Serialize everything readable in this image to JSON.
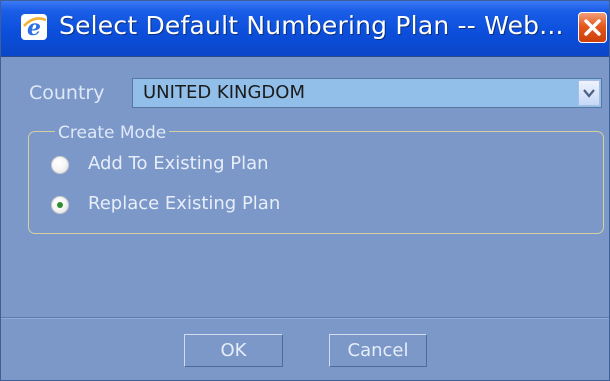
{
  "window": {
    "title": "Select Default Numbering Plan -- Web...",
    "app_icon": "internet-explorer-icon",
    "close_icon": "close-icon"
  },
  "country": {
    "label": "Country",
    "selected_value": "UNITED KINGDOM",
    "dropdown_icon": "chevron-down-icon"
  },
  "create_mode": {
    "legend": "Create Mode",
    "options": [
      {
        "label": "Add To Existing Plan",
        "selected": false
      },
      {
        "label": "Replace Existing Plan",
        "selected": true
      }
    ]
  },
  "buttons": {
    "ok_label": "OK",
    "cancel_label": "Cancel"
  },
  "colors": {
    "titlebar": "#0c4fdc",
    "body": "#7b98c9",
    "close_button": "#e4581c",
    "select_background": "#92bfe9"
  }
}
